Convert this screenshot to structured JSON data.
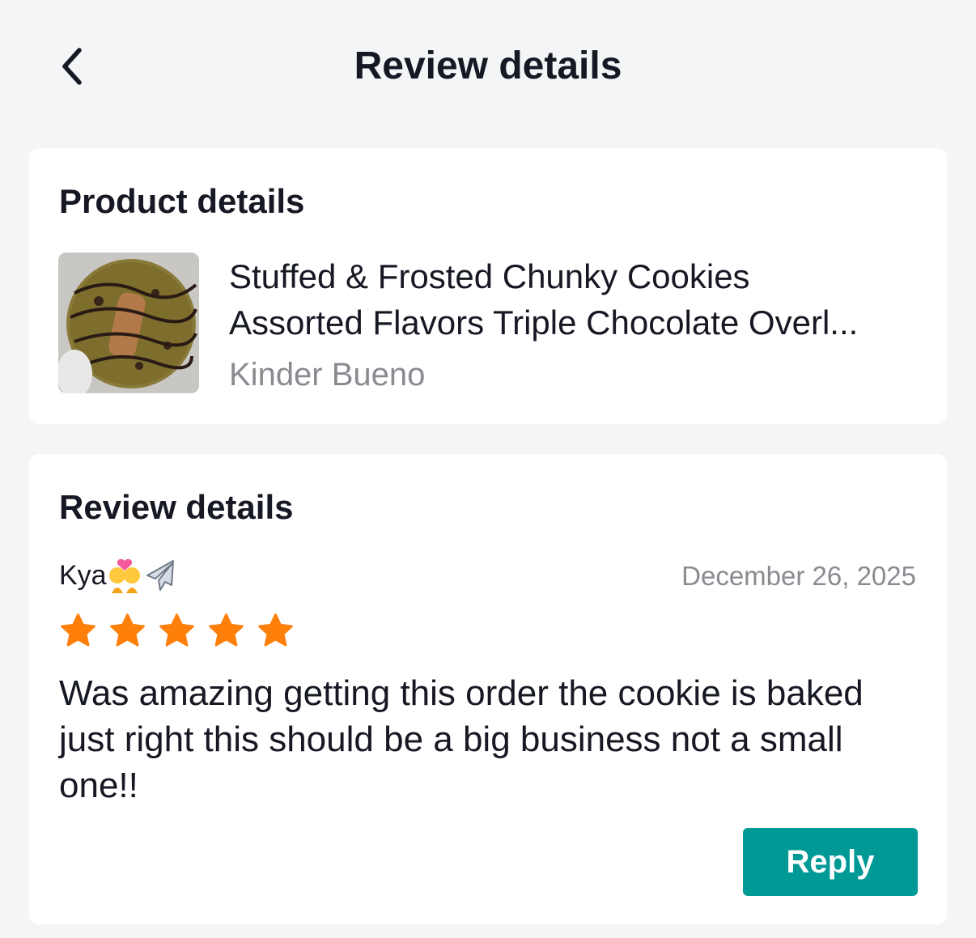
{
  "header": {
    "title": "Review details",
    "back_icon": "chevron-left-icon"
  },
  "product_card": {
    "heading": "Product details",
    "title_line1": "Stuffed & Frosted Chunky Cookies",
    "title_line2": "Assorted Flavors Triple Chocolate Overl...",
    "variant": "Kinder Bueno",
    "thumbnail": "cookie-product-image"
  },
  "review_card": {
    "heading": "Review details",
    "reviewer_name": "Kya",
    "reviewer_emojis": [
      "couple-with-heart-emoji",
      "airplane-emoji"
    ],
    "date": "December 26, 2025",
    "rating": 5,
    "rating_max": 5,
    "star_color": "#fe7f0a",
    "text": "Was amazing getting this order the cookie is baked just right this should be a big business not a small one!!",
    "reply_label": "Reply",
    "reply_color": "#009995"
  }
}
